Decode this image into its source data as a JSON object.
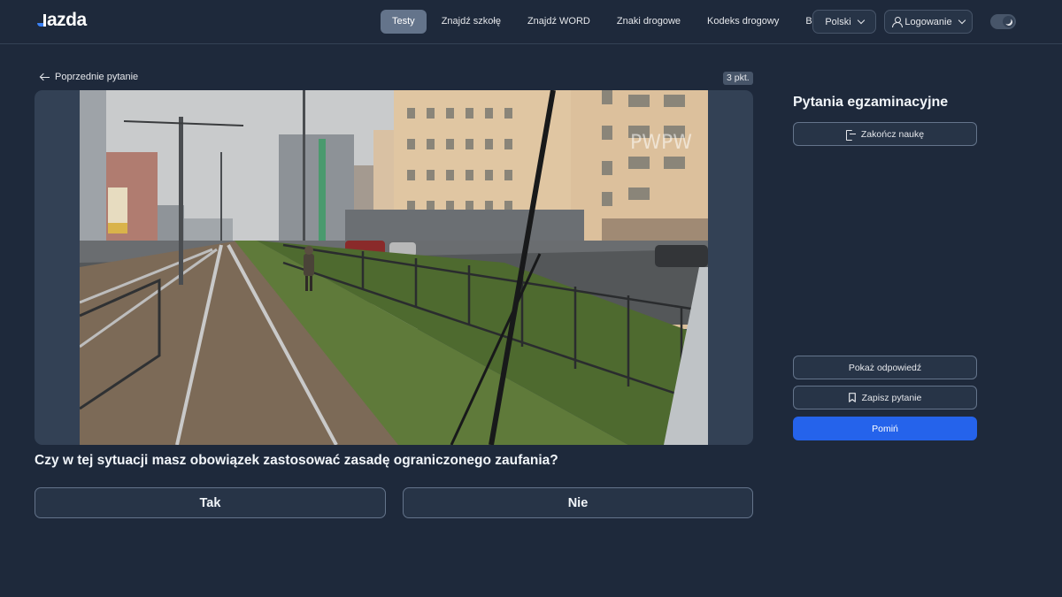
{
  "header": {
    "logo_text": "azda",
    "nav": [
      {
        "label": "Testy",
        "active": true
      },
      {
        "label": "Znajdź szkołę",
        "active": false
      },
      {
        "label": "Znajdź WORD",
        "active": false
      },
      {
        "label": "Znaki drogowe",
        "active": false
      },
      {
        "label": "Kodeks drogowy",
        "active": false
      },
      {
        "label": "Blog",
        "active": false
      }
    ],
    "language_label": "Polski",
    "login_label": "Logowanie",
    "theme_toggle_icon": "moon-icon"
  },
  "question": {
    "prev_label": "Poprzednie pytanie",
    "points_label": "3 pkt.",
    "media_watermark": "PWPW",
    "text": "Czy w tej sytuacji masz obowiązek zastosować zasadę ograniczonego zaufania?",
    "answers": {
      "yes": "Tak",
      "no": "Nie"
    }
  },
  "sidebar": {
    "title": "Pytania egzaminacyjne",
    "end_label": "Zakończ naukę",
    "show_answer_label": "Pokaż odpowiedź",
    "save_label": "Zapisz pytanie",
    "skip_label": "Pomiń"
  },
  "colors": {
    "background": "#1e293b",
    "accent": "#2563eb",
    "active_nav": "#64748b"
  }
}
